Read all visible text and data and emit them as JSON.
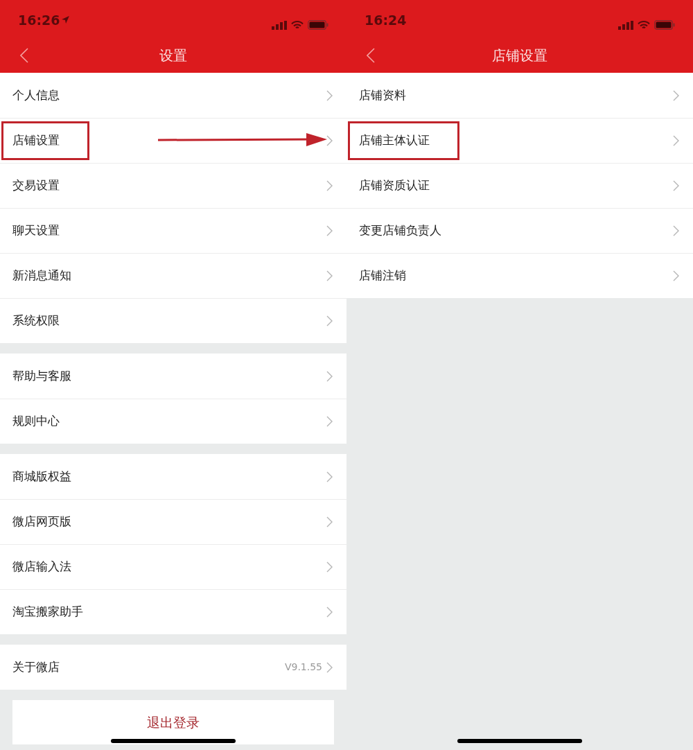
{
  "screens": [
    {
      "status_bar": {
        "time": "16:26",
        "location": true
      },
      "title": "设置",
      "groups": [
        [
          {
            "label": "个人信息",
            "highlighted": false
          },
          {
            "label": "店铺设置",
            "highlighted": true
          },
          {
            "label": "交易设置",
            "highlighted": false
          },
          {
            "label": "聊天设置",
            "highlighted": false
          },
          {
            "label": "新消息通知",
            "highlighted": false
          },
          {
            "label": "系统权限",
            "highlighted": false
          }
        ],
        [
          {
            "label": "帮助与客服",
            "highlighted": false
          },
          {
            "label": "规则中心",
            "highlighted": false
          }
        ],
        [
          {
            "label": "商城版权益",
            "highlighted": false
          },
          {
            "label": "微店网页版",
            "highlighted": false
          },
          {
            "label": "微店输入法",
            "highlighted": false
          },
          {
            "label": "淘宝搬家助手",
            "highlighted": false
          }
        ],
        [
          {
            "label": "关于微店",
            "highlighted": false,
            "value": "V9.1.55"
          }
        ]
      ],
      "logout_button": "退出登录"
    },
    {
      "status_bar": {
        "time": "16:24",
        "location": false
      },
      "title": "店铺设置",
      "groups": [
        [
          {
            "label": "店铺资料",
            "highlighted": false
          },
          {
            "label": "店铺主体认证",
            "highlighted": true
          },
          {
            "label": "店铺资质认证",
            "highlighted": false
          },
          {
            "label": "变更店铺负责人",
            "highlighted": false
          },
          {
            "label": "店铺注销",
            "highlighted": false
          }
        ]
      ]
    }
  ]
}
